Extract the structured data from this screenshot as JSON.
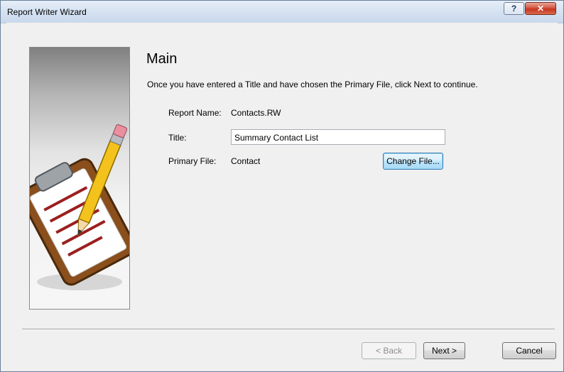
{
  "window": {
    "title": "Report Writer Wizard",
    "help_label": "?",
    "close_label": "✕"
  },
  "main": {
    "heading": "Main",
    "instruction": "Once you have entered a Title and have chosen the Primary File, click Next to continue.",
    "report_name_label": "Report Name:",
    "report_name_value": "Contacts.RW",
    "title_label": "Title:",
    "title_value": "Summary Contact List",
    "primary_file_label": "Primary File:",
    "primary_file_value": "Contact",
    "change_file_button": "Change File..."
  },
  "footer": {
    "back_button": "< Back",
    "next_button": "Next >",
    "cancel_button": "Cancel"
  },
  "icons": {
    "side_image": "clipboard-pencil-icon"
  }
}
